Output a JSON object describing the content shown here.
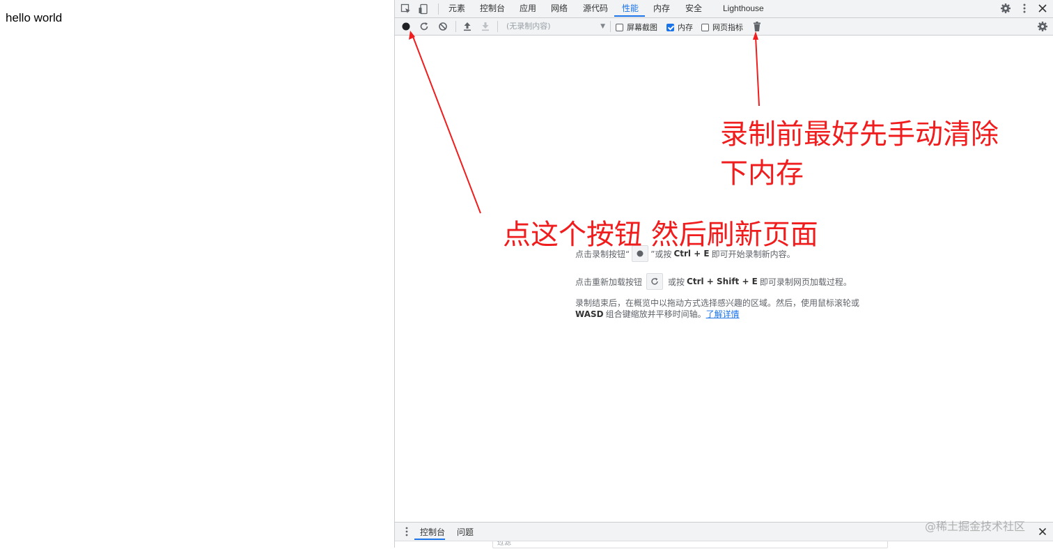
{
  "page": {
    "text": "hello world"
  },
  "devtools": {
    "tabs": [
      "元素",
      "控制台",
      "应用",
      "网络",
      "源代码",
      "性能",
      "内存",
      "安全",
      "Lighthouse"
    ],
    "active_tab": "性能",
    "toolbar": {
      "select_placeholder": "(无录制内容)",
      "screenshots_label": "屏幕截图",
      "screenshots_checked": false,
      "memory_label": "内存",
      "memory_checked": true,
      "web_vitals_label": "网页指标",
      "web_vitals_checked": false
    },
    "landing": {
      "record_pre": "点击录制按钮“",
      "record_post": "”或按",
      "record_shortcut": "Ctrl + E",
      "record_tail": "即可开始录制新内容。",
      "reload_pre": "点击重新加载按钮",
      "reload_mid": "或按",
      "reload_shortcut": "Ctrl + Shift + E",
      "reload_tail": "即可录制网页加载过程。",
      "hint_line1": "录制结束后，在概览中以拖动方式选择感兴趣的区域。然后，使用鼠标滚轮或",
      "hint_bold": "WASD",
      "hint_line2": "组合键缩放并平移时间轴。",
      "learn_more": "了解详情"
    },
    "drawer": {
      "tabs": [
        "控制台",
        "问题"
      ],
      "active_tab": "控制台",
      "filter_placeholder": "过滤"
    }
  },
  "annotations": {
    "record_note": "点这个按钮 然后刷新页面",
    "gc_note_line1": "录制前最好先手动清除",
    "gc_note_line2": "下内存",
    "color": "#ef1d1d"
  },
  "watermark": "@稀土掘金技术社区"
}
